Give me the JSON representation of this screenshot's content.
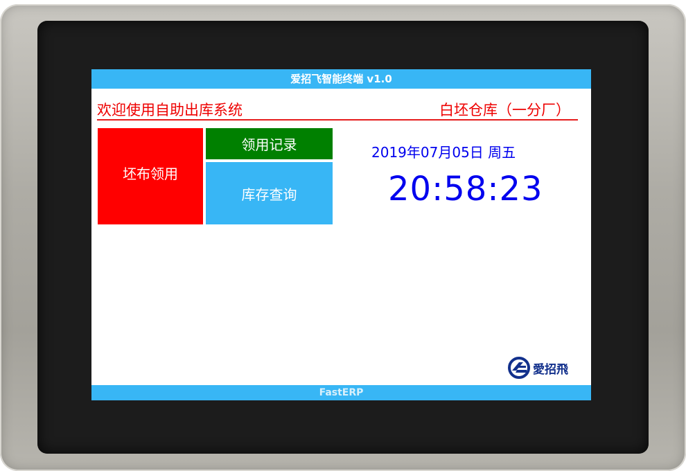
{
  "header": {
    "title": "爱招飞智能终端 v1.0"
  },
  "banner": {
    "welcome": "欢迎使用自助出库系统",
    "warehouse": "白坯仓库（一分厂）"
  },
  "actions": {
    "issue_label": "坯布领用",
    "records_label": "领用记录",
    "inventory_label": "库存查询"
  },
  "clock": {
    "date": "2019年07月05日 周五",
    "time": "20:58:23"
  },
  "brand": {
    "logo_text": "愛招飛",
    "logo_icon": "aizhaofei-logo-icon"
  },
  "footer": {
    "text": "FastERP"
  },
  "colors": {
    "bar_blue": "#38b6f5",
    "accent_red": "#ff0000",
    "records_green": "#008000",
    "clock_blue": "#0000ee"
  }
}
